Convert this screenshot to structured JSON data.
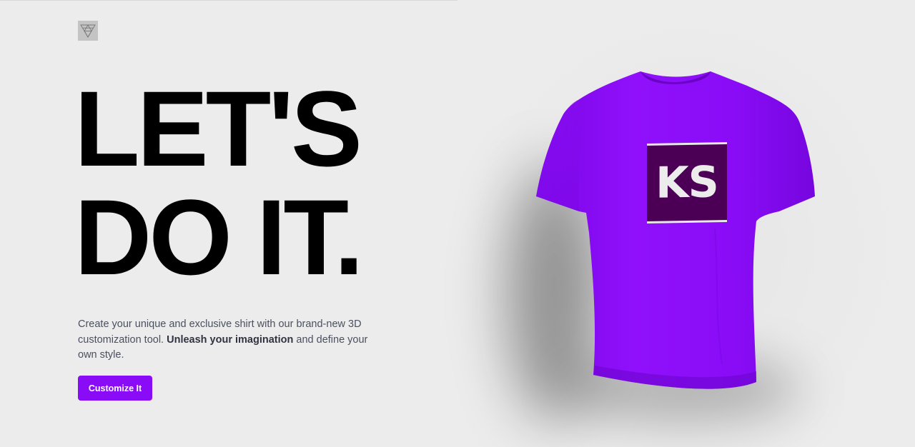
{
  "brand": {
    "logo_icon": "triangle-mesh-logo-icon"
  },
  "hero": {
    "headline_line1": "LET'S",
    "headline_line2": "DO IT.",
    "description_part1": "Create your unique and exclusive shirt with our brand-new 3D customization tool. ",
    "description_emphasis": "Unleash your imagination",
    "description_part2": " and define your own style.",
    "cta_label": "Customize It"
  },
  "product": {
    "shirt_color": "#8b0bf7",
    "decal_text": "KS",
    "decal_background": "#4b0056"
  },
  "colors": {
    "accent": "#8a0cf7",
    "background": "#ececec"
  }
}
